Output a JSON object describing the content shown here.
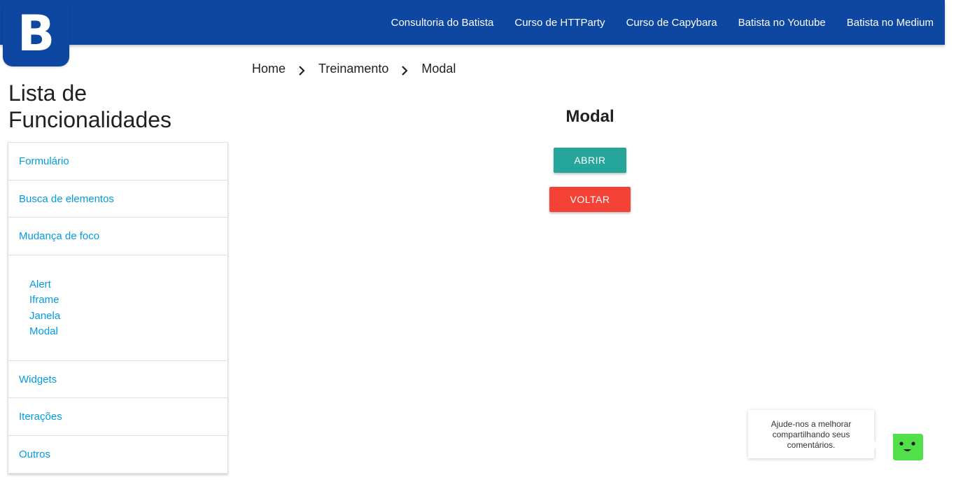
{
  "logo": {
    "letter": "B"
  },
  "nav": {
    "links": [
      "Consultoria do Batista",
      "Curso de HTTParty",
      "Curso de Capybara",
      "Batista no Youtube",
      "Batista no Medium"
    ]
  },
  "sidebar": {
    "title": "Lista de Funcionalidades",
    "items": [
      {
        "label": "Formulário"
      },
      {
        "label": "Busca de elementos"
      },
      {
        "label": "Mudança de foco"
      }
    ],
    "subitems": [
      {
        "label": "Alert"
      },
      {
        "label": "Iframe"
      },
      {
        "label": "Janela"
      },
      {
        "label": "Modal"
      }
    ],
    "items_after": [
      {
        "label": "Widgets"
      },
      {
        "label": "Iterações"
      },
      {
        "label": "Outros"
      }
    ]
  },
  "breadcrumb": [
    "Home",
    "Treinamento",
    "Modal"
  ],
  "main": {
    "title": "Modal",
    "open_button": "ABRIR",
    "back_button": "VOLTAR"
  },
  "feedback": {
    "line1": "Ajude-nos a melhorar",
    "line2": "compartilhando seus",
    "line3": "comentários."
  },
  "colors": {
    "navbar": "#0d47a1",
    "link": "#039be5",
    "open_button": "#26a69a",
    "back_button": "#f44336",
    "feedback_bot": "#52e04a"
  }
}
